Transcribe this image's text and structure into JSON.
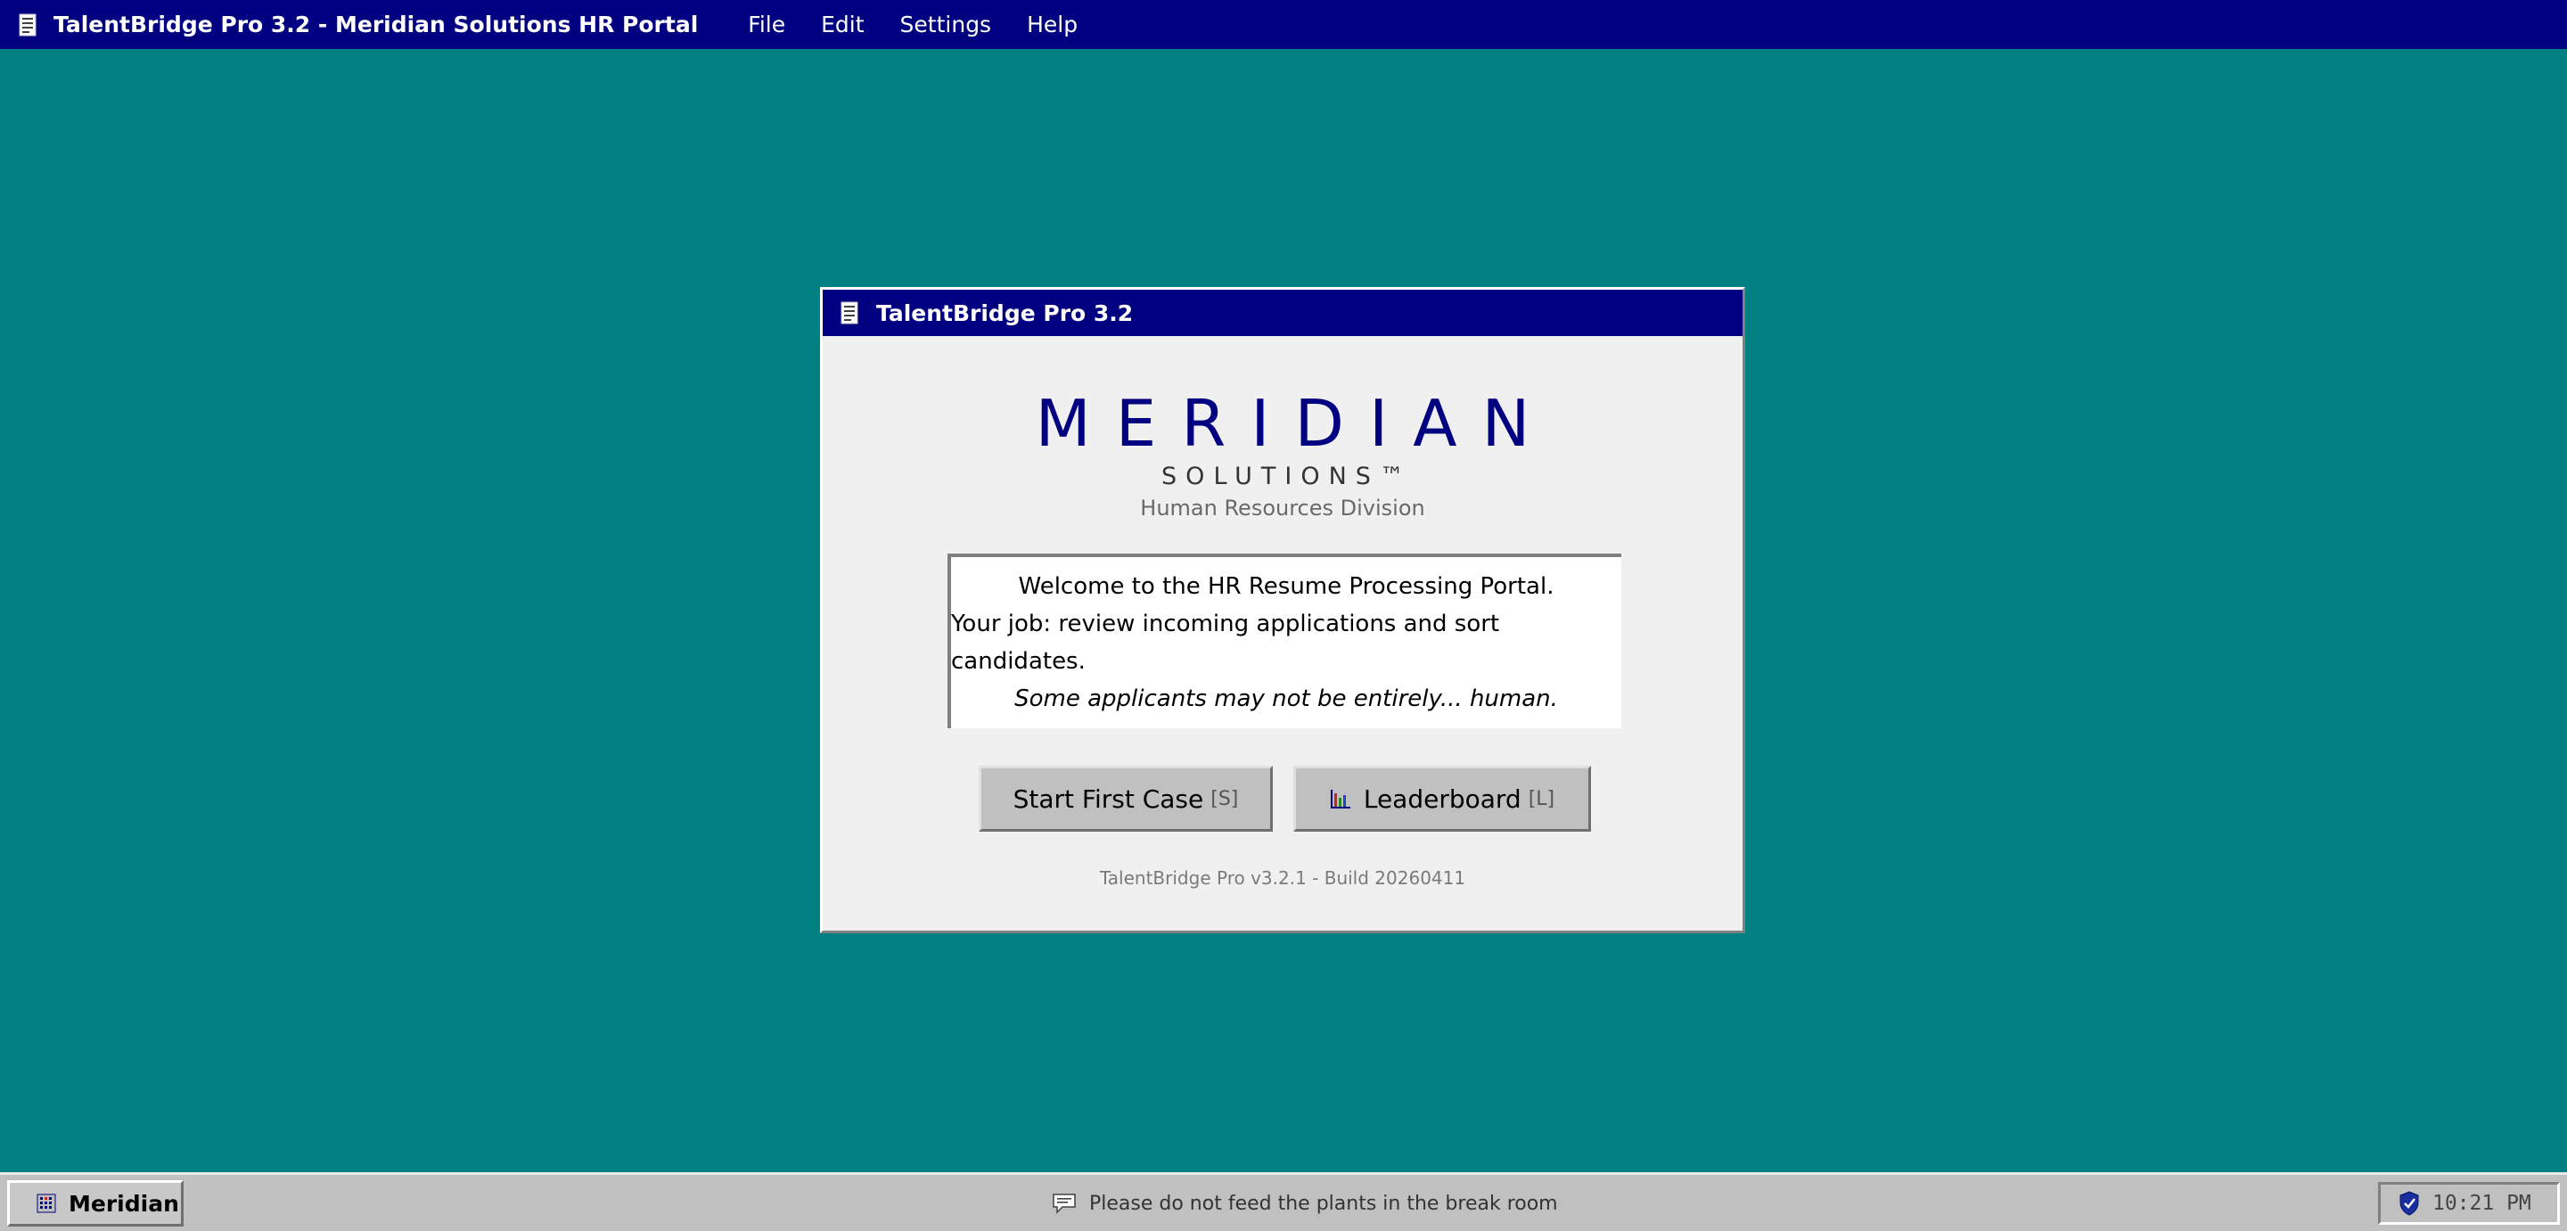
{
  "app": {
    "title": "TalentBridge Pro 3.2 - Meridian Solutions HR Portal",
    "icon": "document-icon"
  },
  "menu": {
    "items": [
      {
        "label": "File"
      },
      {
        "label": "Edit"
      },
      {
        "label": "Settings"
      },
      {
        "label": "Help"
      }
    ]
  },
  "dialog": {
    "title": "TalentBridge Pro 3.2",
    "brand_main": "MERIDIAN",
    "brand_sub": "SOLUTIONS™",
    "brand_division": "Human Resources Division",
    "welcome": {
      "line1": "Welcome to the HR Resume Processing Portal.",
      "line2": "Your job: review incoming applications and sort candidates.",
      "line3": "Some applicants may not be entirely... human."
    },
    "buttons": {
      "start_label": "Start First Case",
      "start_shortcut": "[S]",
      "leaderboard_label": "Leaderboard",
      "leaderboard_shortcut": "[L]"
    },
    "build_info": "TalentBridge Pro v3.2.1 - Build 20260411"
  },
  "taskbar": {
    "start_label": "Meridian",
    "ticker": "Please do not feed the plants in the break room",
    "clock": "10:21 PM"
  },
  "colors": {
    "desktop": "#008080",
    "titlebar": "#000080",
    "chrome": "#c0c0c0"
  }
}
